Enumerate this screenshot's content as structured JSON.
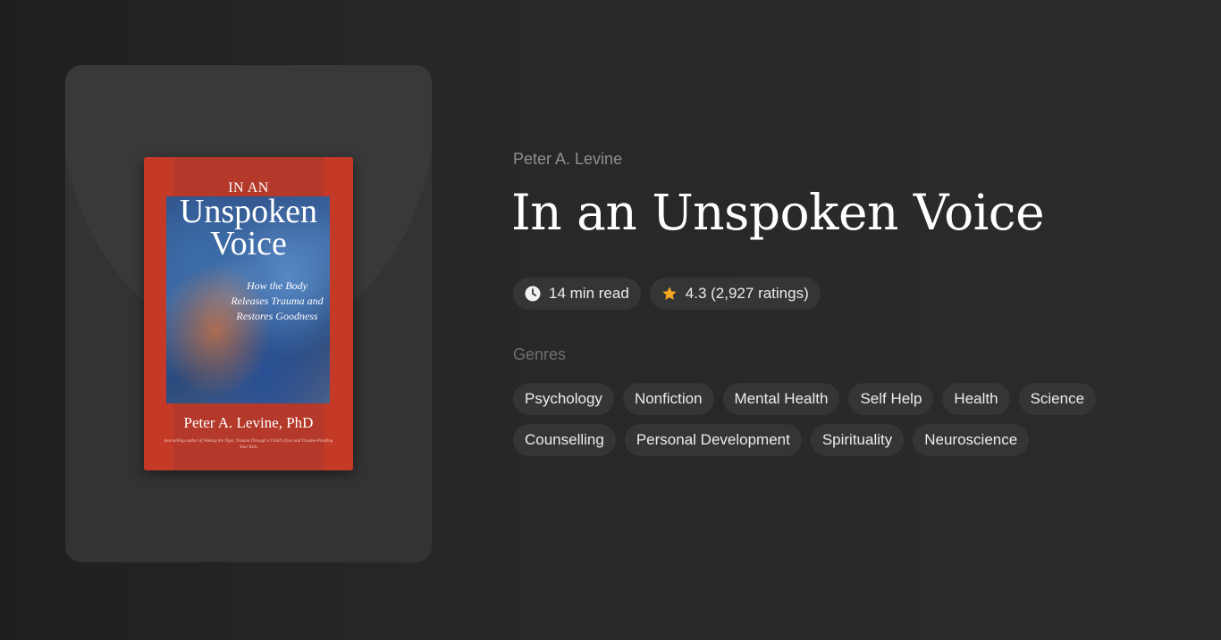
{
  "book": {
    "cover": {
      "title_small": "IN AN",
      "title_line1": "Unspoken",
      "title_line2": "Voice",
      "subtitle": "How the Body Releases Trauma and Restores Goodness",
      "author": "Peter A. Levine, PhD",
      "blurb": "best-selling author of Waking the Tiger, Trauma Through a Child's Eyes and Trauma-Proofing Your Kids"
    },
    "author": "Peter A. Levine",
    "title": "In an Unspoken Voice"
  },
  "meta": {
    "read_time": "14 min read",
    "read_time_icon": "clock-icon",
    "rating": "4.3 (2,927 ratings)",
    "rating_icon": "star-icon",
    "star_color": "#f5a623"
  },
  "genres": {
    "label": "Genres",
    "items": [
      "Psychology",
      "Nonfiction",
      "Mental Health",
      "Self Help",
      "Health",
      "Science",
      "Counselling",
      "Personal Development",
      "Spirituality",
      "Neuroscience"
    ]
  }
}
